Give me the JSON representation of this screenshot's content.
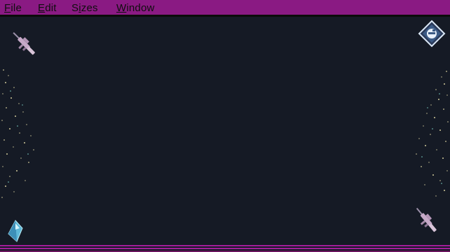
{
  "menubar": {
    "items": [
      {
        "label": "File",
        "accel": "F",
        "rest": "ile"
      },
      {
        "label": "Edit",
        "accel": "E",
        "rest": "dit"
      },
      {
        "label": "Sizes",
        "accel": "i",
        "pre": "S",
        "rest": "zes"
      },
      {
        "label": "Window",
        "accel": "W",
        "rest": "indow"
      }
    ]
  },
  "colors": {
    "menubar": "#8a1a83",
    "background": "#151a25",
    "accent_line": "#a31d9b"
  },
  "icons": {
    "top_left": "rifle-icon",
    "top_right": "diamond-e-badge-icon",
    "bottom_left": "crystal-gem-icon",
    "bottom_right": "rifle-icon"
  }
}
